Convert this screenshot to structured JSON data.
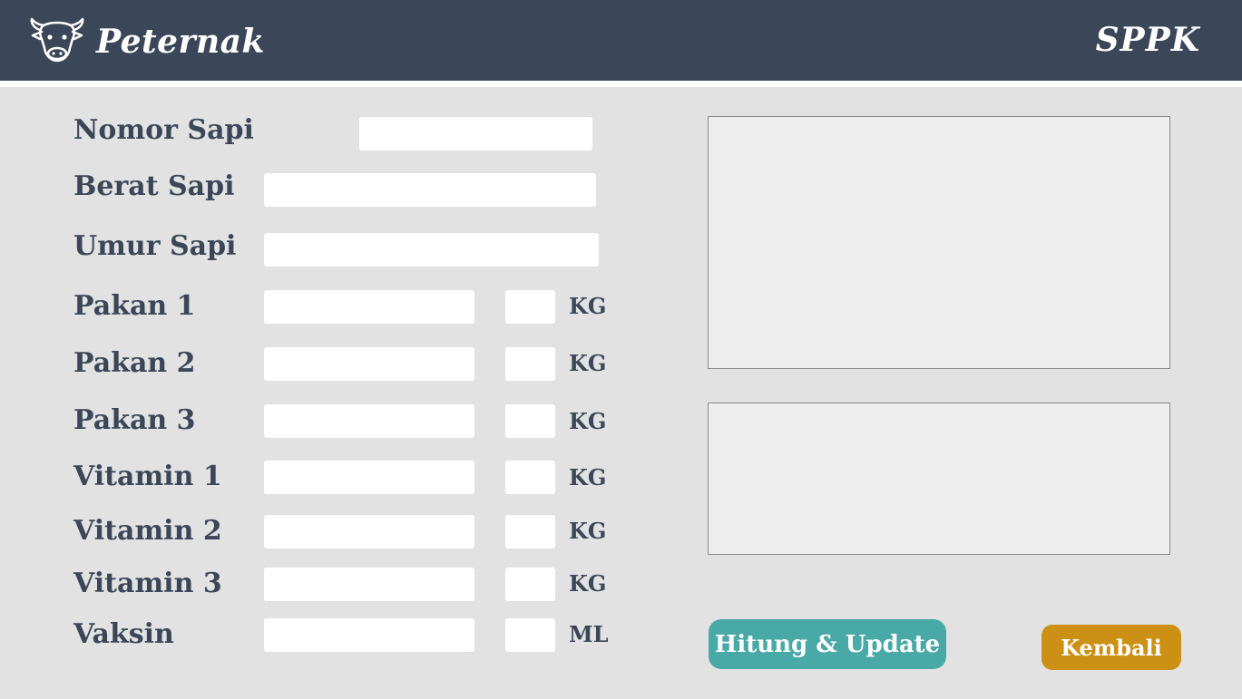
{
  "header": {
    "logo_icon": "cow-head-icon",
    "brand": "Peternak",
    "app_code": "SPPK"
  },
  "form": {
    "nomor_sapi": {
      "label": "Nomor Sapi",
      "value": ""
    },
    "berat_sapi": {
      "label": "Berat Sapi",
      "value": ""
    },
    "umur_sapi": {
      "label": "Umur Sapi",
      "value": ""
    },
    "items": [
      {
        "label": "Pakan 1",
        "value": "",
        "amount": "",
        "unit": "KG"
      },
      {
        "label": "Pakan 2",
        "value": "",
        "amount": "",
        "unit": "KG"
      },
      {
        "label": "Pakan 3",
        "value": "",
        "amount": "",
        "unit": "KG"
      },
      {
        "label": "Vitamin 1",
        "value": "",
        "amount": "",
        "unit": "KG"
      },
      {
        "label": "Vitamin 2",
        "value": "",
        "amount": "",
        "unit": "KG"
      },
      {
        "label": "Vitamin 3",
        "value": "",
        "amount": "",
        "unit": "KG"
      },
      {
        "label": "Vaksin",
        "value": "",
        "amount": "",
        "unit": "ML"
      }
    ]
  },
  "panels": {
    "upper": "",
    "lower": ""
  },
  "actions": {
    "calculate_label": "Hitung & Update",
    "back_label": "Kembali"
  },
  "colors": {
    "header_bg": "#3b4759",
    "main_bg": "#e2e2e2",
    "text_dark": "#3b4759",
    "calc_button": "#49a9a6",
    "back_button": "#cc9114",
    "panel_bg": "#eeeeee"
  }
}
